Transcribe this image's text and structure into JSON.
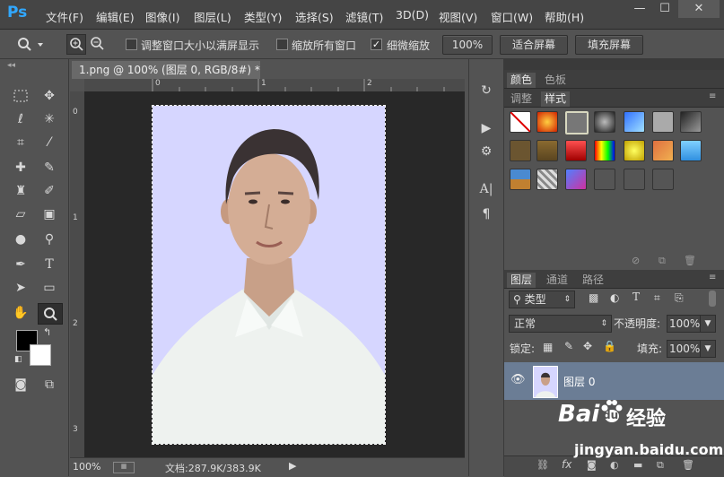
{
  "app": {
    "logo": "Ps"
  },
  "menu": [
    "文件(F)",
    "编辑(E)",
    "图像(I)",
    "图层(L)",
    "类型(Y)",
    "选择(S)",
    "滤镜(T)",
    "3D(D)",
    "视图(V)",
    "窗口(W)",
    "帮助(H)"
  ],
  "window_controls": {
    "minimize": "—",
    "maximize": "☐",
    "close": "✕"
  },
  "options": {
    "resize_windows_label": "调整窗口大小以满屏显示",
    "resize_windows_checked": false,
    "zoom_all_label": "缩放所有窗口",
    "zoom_all_checked": false,
    "scrubby_zoom_label": "细微缩放",
    "scrubby_zoom_checked": true,
    "zoom_100_label": "100%",
    "fit_screen_label": "适合屏幕",
    "fill_screen_label": "填充屏幕"
  },
  "document": {
    "tab_title": "1.png @ 100% (图层 0, RGB/8#) *",
    "ruler_h_marks": [
      "0",
      "1",
      "2"
    ],
    "ruler_v_marks": [
      "0",
      "1",
      "2",
      "3"
    ],
    "bg_color": "#d6d6ff"
  },
  "status": {
    "zoom": "100%",
    "doc_size": "文档:287.9K/383.9K"
  },
  "panels": {
    "top_tabs": [
      "颜色",
      "色板"
    ],
    "style_tabs": [
      "调整",
      "样式"
    ],
    "layers_tabs": [
      "图层",
      "通道",
      "路径"
    ],
    "filter_kind": "类型",
    "blend_mode": "正常",
    "opacity_label": "不透明度:",
    "opacity_value": "100%",
    "lock_label": "锁定:",
    "fill_label": "填充:",
    "fill_value": "100%",
    "layer_name": "图层 0"
  },
  "watermark": {
    "brand": "Bai",
    "paw": "du",
    "suffix": "经验",
    "url": "jingyan.baidu.com"
  },
  "colors": {
    "accent": "#31a8ff",
    "selected_layer": "#6b7d95"
  }
}
